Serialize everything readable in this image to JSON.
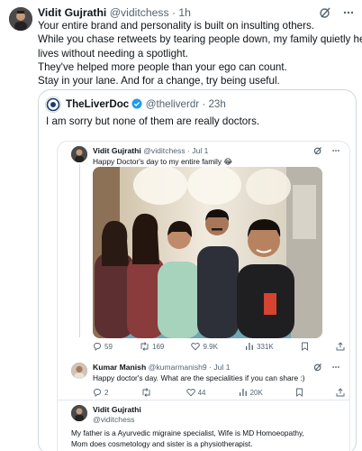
{
  "main_tweet": {
    "author_name": "Vidit Gujrathi",
    "handle_time": "@viditchess · 1h",
    "lines": [
      "Your entire brand and personality is built on insulting others.",
      "While you chase retweets by tearing people down, my family quietly heals",
      "lives without needing a spotlight.",
      "They've helped more people than your ego can count.",
      "Stay in your lane. And for a change, try being useful."
    ]
  },
  "quote_tweet": {
    "author_name": "TheLiverDoc",
    "handle_time": "@theliverdr · 23h",
    "text": "I am sorry but none of them are really doctors."
  },
  "thread": {
    "tweet1": {
      "author_name": "Vidit Gujrathi",
      "handle_time": "@viditchess · Jul 1",
      "text": "Happy Doctor's day to my entire family 😂",
      "metrics": {
        "replies": "59",
        "reposts": "169",
        "likes": "9.9K",
        "views": "331K"
      }
    },
    "tweet2": {
      "author_name": "Kumar Manish",
      "handle_time": "@kumarmanish9 · Jul 1",
      "text": "Happy doctor's day. What are the specialities if you can share :)",
      "metrics": {
        "replies": "2",
        "reposts": "",
        "likes": "44",
        "views": "20K"
      }
    },
    "tweet3": {
      "author_name": "Vidit Gujrathi",
      "handle": "@viditchess",
      "lines": [
        "My father is a Ayurvedic migraine specialist, Wife is MD Homoeopathy,",
        "Mom does cosmetology and sister is a physiotherapist."
      ]
    }
  }
}
